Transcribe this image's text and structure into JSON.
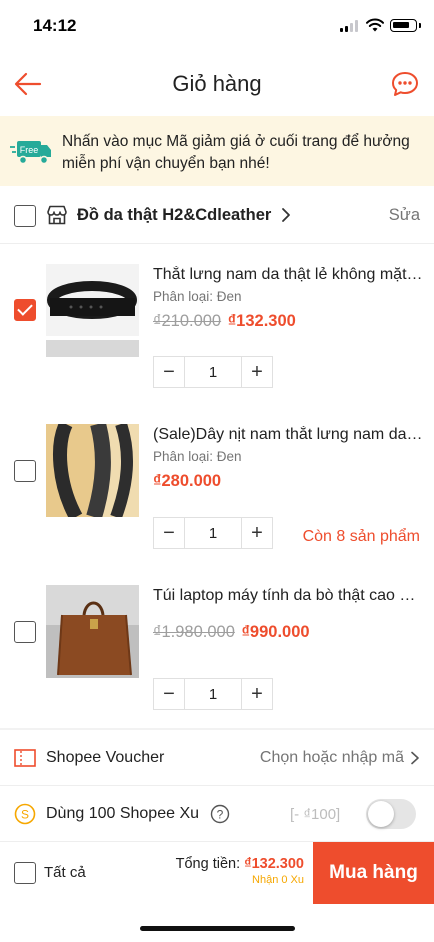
{
  "status_bar": {
    "time": "14:12"
  },
  "header": {
    "title": "Giỏ hàng"
  },
  "banner": {
    "badge": "Free",
    "text": "Nhấn vào mục Mã giảm giá ở cuối trang để hưởng miễn phí vận chuyển bạn nhé!"
  },
  "shop": {
    "name": "Đồ da thật H2&Cdleather",
    "edit_label": "Sửa"
  },
  "items": [
    {
      "name": "Thắt lưng nam da thật lẻ không mặt khóa",
      "variant": "Phân loại: Đen",
      "old_price": "₫210.000",
      "price": "₫132.300",
      "quantity": "1",
      "stock_note": "",
      "checked": true
    },
    {
      "name": "(Sale)Dây nịt nam thắt lưng nam da bò",
      "variant": "Phân loại: Đen",
      "old_price": "",
      "price": "₫280.000",
      "quantity": "1",
      "stock_note": "Còn 8 sản phẩm",
      "checked": false
    },
    {
      "name": "Túi laptop máy tính da bò thật cao cấp",
      "variant": "",
      "old_price": "₫1.980.000",
      "price": "₫990.000",
      "quantity": "1",
      "stock_note": "",
      "checked": false
    }
  ],
  "voucher": {
    "label": "Shopee Voucher",
    "action": "Chọn hoặc nhập mã"
  },
  "coins": {
    "label": "Dùng 100 Shopee Xu",
    "discount": "[- ₫100]"
  },
  "footer": {
    "select_all": "Tất cả",
    "total_label": "Tổng tiền:",
    "total_value": "₫132.300",
    "coins_earned": "Nhận 0 Xu",
    "buy_label": "Mua hàng"
  },
  "colors": {
    "accent": "#ee4d2d",
    "banner_bg": "#fdf6e2",
    "free_badge": "#26aa99",
    "coin": "#f6a700"
  }
}
